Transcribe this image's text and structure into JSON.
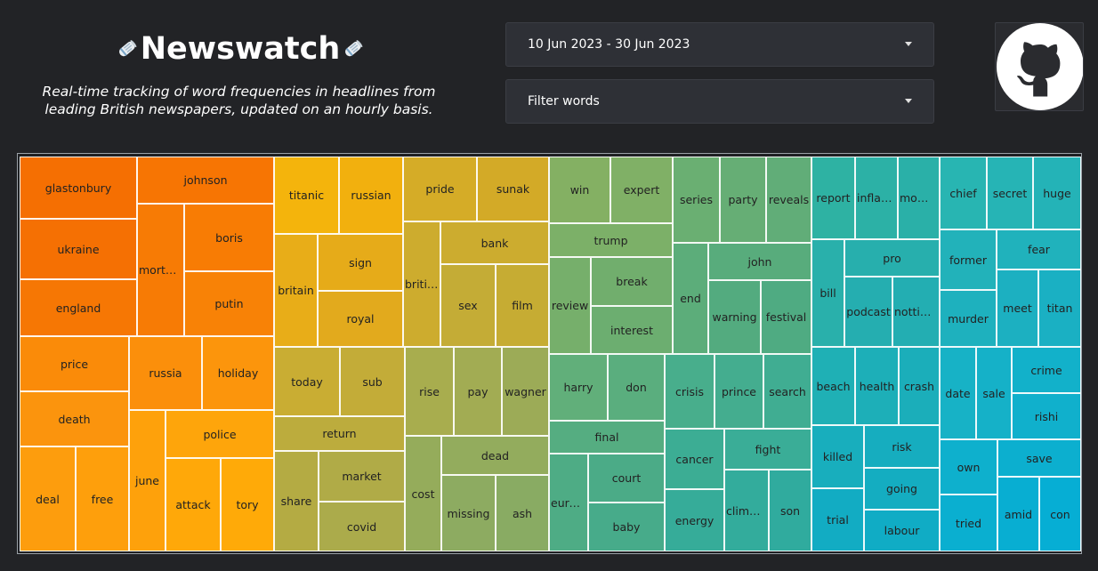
{
  "header": {
    "title": "Newswatch",
    "subtitle": "Real-time tracking of word frequencies in headlines from leading British newspapers, updated on an hourly basis."
  },
  "controls": {
    "date_range": "10 Jun 2023 - 30 Jun 2023",
    "filter_words_placeholder": "Filter words"
  },
  "github": {
    "icon": "github-icon"
  },
  "treemap": {
    "words": [
      "glastonbury",
      "johnson",
      "titanic",
      "russian",
      "pride",
      "sunak",
      "win",
      "expert",
      "series",
      "party",
      "reveals",
      "report",
      "inflation",
      "moment",
      "chief",
      "secret",
      "huge",
      "ukraine",
      "mortgage",
      "boris",
      "britain",
      "sign",
      "british",
      "bank",
      "trump",
      "john",
      "pro",
      "fear",
      "former",
      "sex",
      "film",
      "review",
      "break",
      "end",
      "warning",
      "festival",
      "bill",
      "podcast",
      "notting…",
      "murder",
      "meet",
      "titan",
      "england",
      "putin",
      "royal",
      "interest",
      "price",
      "russia",
      "holiday",
      "today",
      "sub",
      "rise",
      "pay",
      "wagner",
      "harry",
      "don",
      "crisis",
      "prince",
      "search",
      "beach",
      "health",
      "crash",
      "date",
      "sale",
      "crime",
      "rishi",
      "death",
      "police",
      "return",
      "dead",
      "final",
      "cancer",
      "fight",
      "killed",
      "risk",
      "deal",
      "free",
      "june",
      "attack",
      "tory",
      "share",
      "market",
      "covid",
      "cost",
      "missing",
      "ash",
      "court",
      "europe",
      "baby",
      "energy",
      "climate",
      "son",
      "trial",
      "going",
      "labour",
      "own",
      "tried",
      "save",
      "amid",
      "con"
    ]
  },
  "colors": {
    "background": "#222326",
    "panel": "#2e3036",
    "tile_orange_dark": "#f56f02",
    "tile_teal": "#25b7b2",
    "tile_cyan": "#00b7cc"
  }
}
